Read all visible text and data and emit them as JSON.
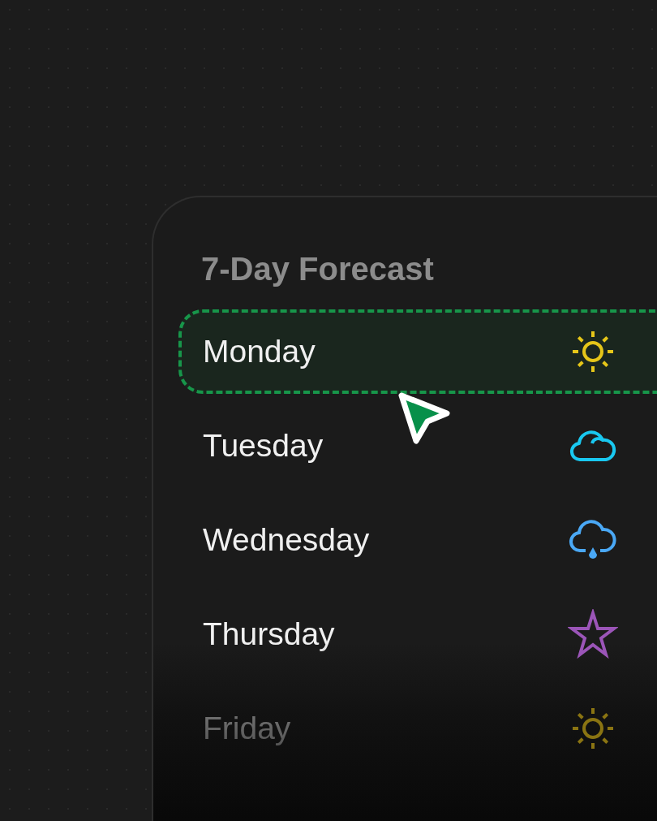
{
  "card": {
    "title": "7-Day Forecast"
  },
  "days": [
    {
      "name": "Monday",
      "kind": "sun",
      "color": "#e6c619",
      "selected": true
    },
    {
      "name": "Tuesday",
      "kind": "cloud",
      "color": "#19c8f0",
      "selected": false
    },
    {
      "name": "Wednesday",
      "kind": "rain",
      "color": "#4aa8f5",
      "selected": false
    },
    {
      "name": "Thursday",
      "kind": "star",
      "color": "#9b55b8",
      "selected": false
    },
    {
      "name": "Friday",
      "kind": "sun",
      "color": "#8a7412",
      "selected": false
    }
  ]
}
